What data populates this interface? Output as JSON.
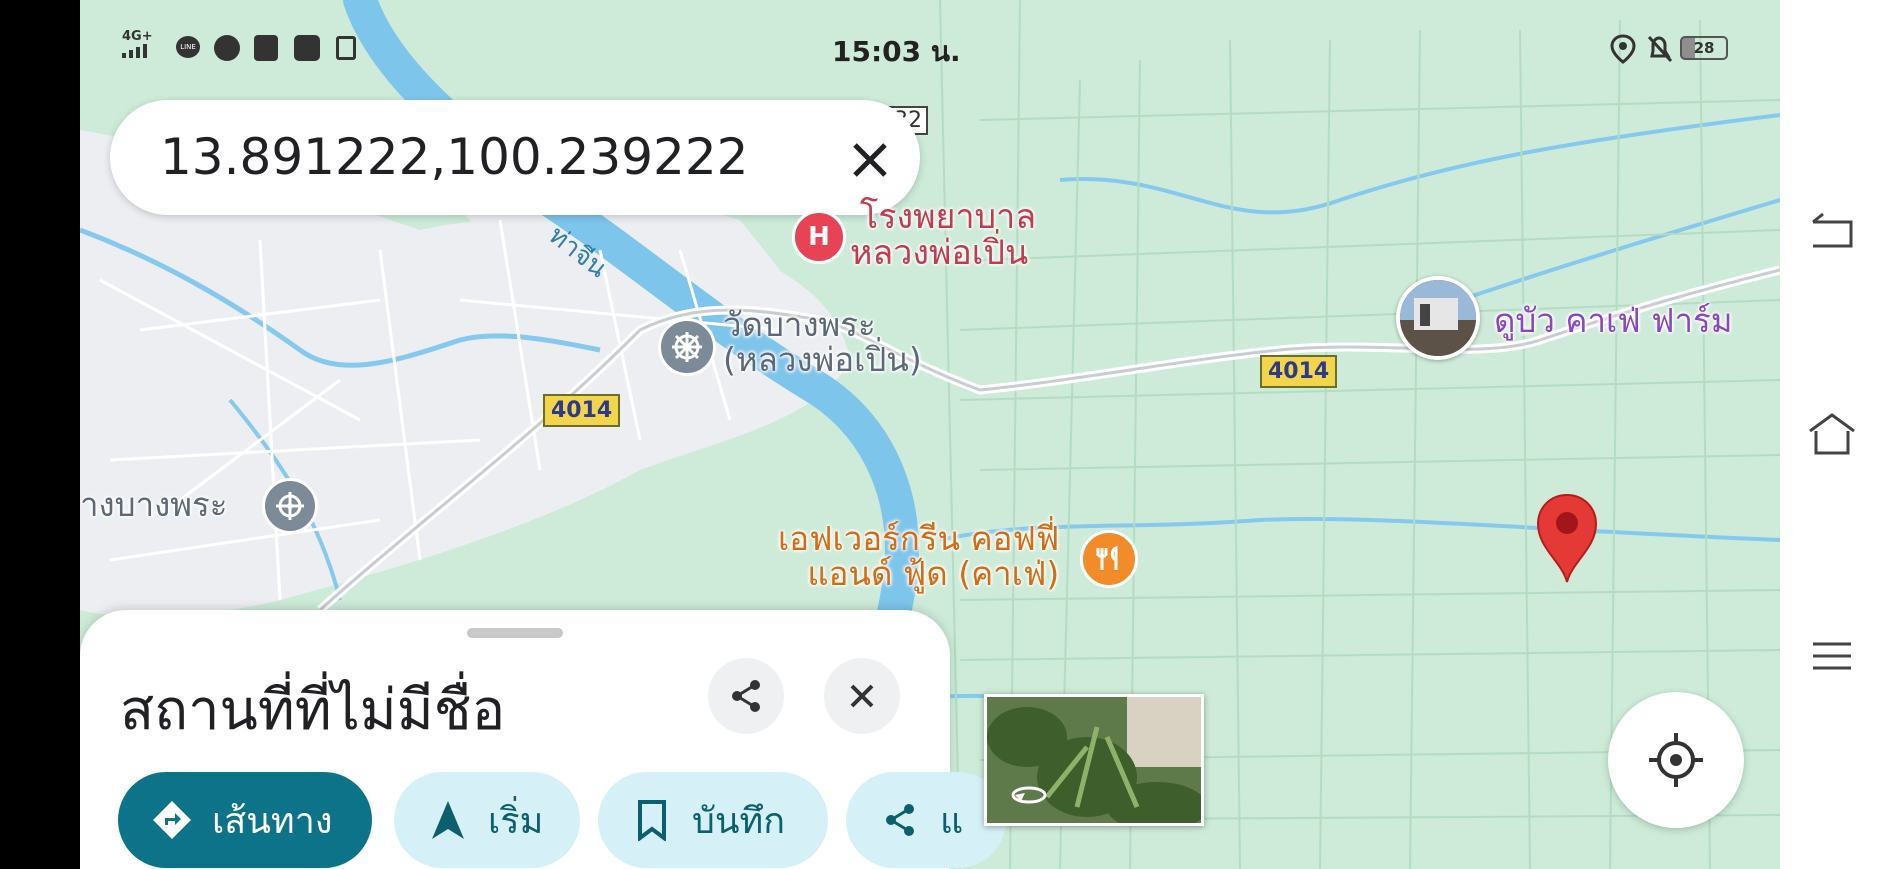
{
  "status_bar": {
    "network": "4G+",
    "line_badge": "LINE",
    "time": "15:03 น.",
    "battery": "28"
  },
  "search": {
    "value": "13.891222,100.239222",
    "partial_label": "32"
  },
  "map": {
    "hospital": {
      "line1": "โรงพยาบาล",
      "line2": "หลวงพ่อเปิ่น"
    },
    "river_label": "ท่าจีน",
    "temple": {
      "line1": "วัดบางพระ",
      "line2": "(หลวงพ่อเปิ่น)"
    },
    "road_badge_left": "4014",
    "road_badge_right": "4014",
    "left_temple_label": "างบางพระ",
    "cafe_farm": "ดูบัว คาเฟ่ ฟาร์ม",
    "restaurant": {
      "line1": "เอฟเวอร์กรีน คอฟฟี่",
      "line2": "แอนด์ ฟู้ด (คาเฟ่)"
    },
    "colors": {
      "land": "#cdebd8",
      "river": "#7ec5ec",
      "urban": "#eef0f3",
      "road": "#ffffff",
      "pin": "#e53935",
      "hospital": "#e84355",
      "restaurant": "#f28c28",
      "cafe_text": "#8b45c8"
    }
  },
  "sheet": {
    "title": "สถานที่ที่ไม่มีชื่อ",
    "chips": [
      {
        "label": "เส้นทาง",
        "icon": "directions-icon"
      },
      {
        "label": "เริ่ม",
        "icon": "navigation-arrow-icon"
      },
      {
        "label": "บันทึก",
        "icon": "bookmark-icon"
      },
      {
        "label": "แ",
        "icon": "share-icon"
      }
    ]
  }
}
